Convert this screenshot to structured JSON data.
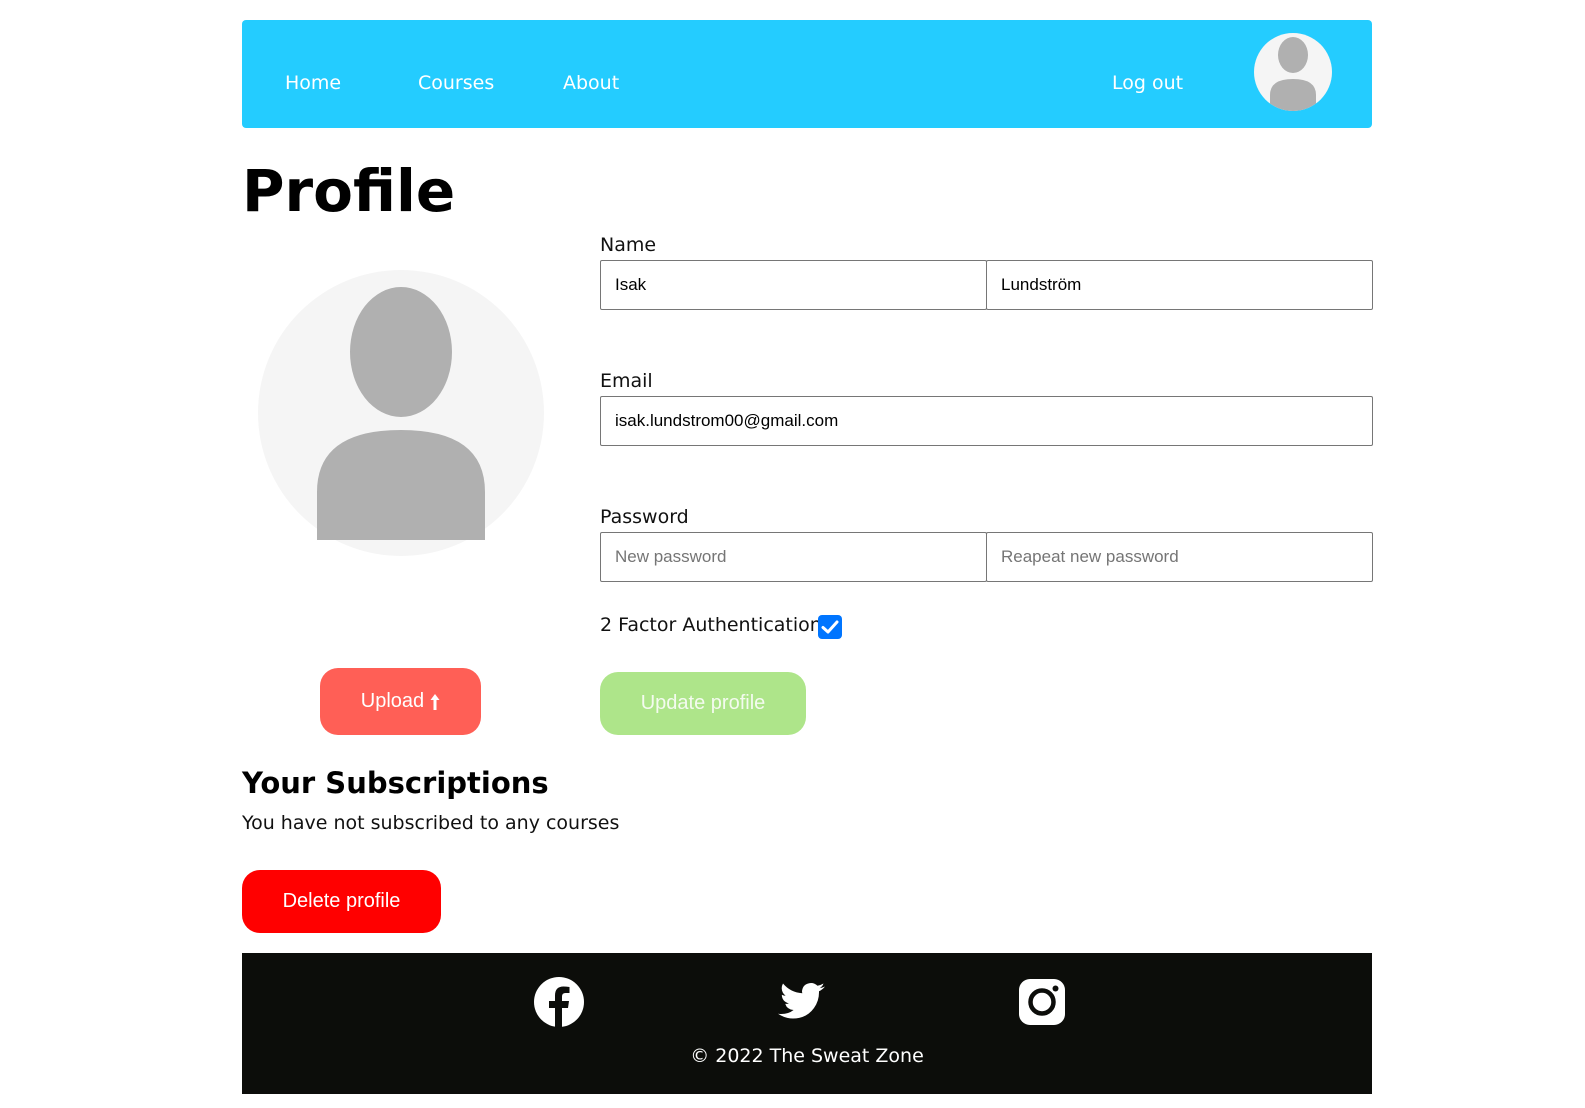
{
  "nav": {
    "links": [
      {
        "label": "Home"
      },
      {
        "label": "Courses"
      },
      {
        "label": "About"
      }
    ],
    "logout_label": "Log out",
    "avatar_icon": "user-avatar-icon"
  },
  "page": {
    "title": "Profile"
  },
  "profile_picture": {
    "icon": "user-silhouette-icon",
    "upload_label": "Upload",
    "upload_icon": "arrow-up-icon"
  },
  "form": {
    "name": {
      "label": "Name",
      "first_value": "Isak",
      "last_value": "Lundström"
    },
    "email": {
      "label": "Email",
      "value": "isak.lundstrom00@gmail.com"
    },
    "password": {
      "label": "Password",
      "new_placeholder": "New password",
      "repeat_placeholder": "Reapeat new password"
    },
    "two_factor": {
      "label": "2 Factor Authentication",
      "checked": true
    },
    "update_label": "Update profile"
  },
  "subscriptions": {
    "title": "Your Subscriptions",
    "empty_text": "You have not subscribed to any courses"
  },
  "delete_label": "Delete profile",
  "footer": {
    "social": [
      {
        "icon": "facebook-icon"
      },
      {
        "icon": "twitter-icon"
      },
      {
        "icon": "instagram-icon"
      }
    ],
    "copyright": "© 2022 The Sweat Zone"
  },
  "colors": {
    "navbar": "#24ccff",
    "upload": "#ff5f56",
    "update": "#aee58a",
    "delete": "#ff0000",
    "footer": "#0c0d0a",
    "checkbox": "#0075ff"
  }
}
